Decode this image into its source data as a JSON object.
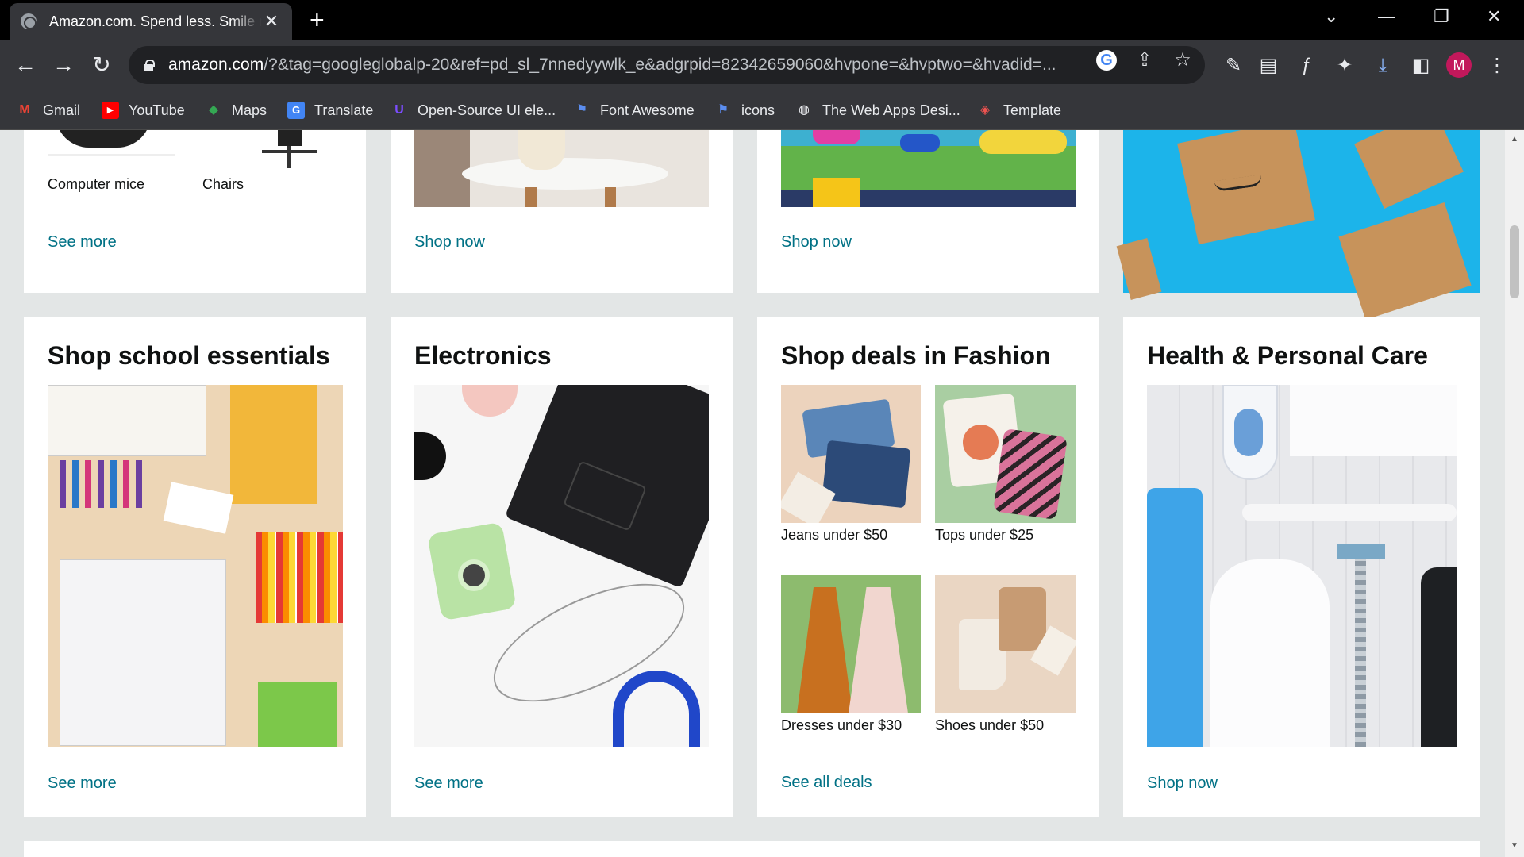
{
  "browser": {
    "tab_title": "Amazon.com. Spend less. Smile more.",
    "url_host": "amazon.com",
    "url_rest": "/?&tag=googleglobalp-20&ref=pd_sl_7nnedyywlk_e&adgrpid=82342659060&hvpone=&hvptwo=&hvadid=...",
    "profile_initial": "M",
    "bookmarks": [
      {
        "label": "Gmail",
        "icon": "gmail-icon"
      },
      {
        "label": "YouTube",
        "icon": "youtube-icon"
      },
      {
        "label": "Maps",
        "icon": "maps-icon"
      },
      {
        "label": "Translate",
        "icon": "translate-icon"
      },
      {
        "label": "Open-Source UI ele...",
        "icon": "ui-icon"
      },
      {
        "label": "Font Awesome",
        "icon": "flag-icon"
      },
      {
        "label": "icons",
        "icon": "flag-icon"
      },
      {
        "label": "The Web Apps Desi...",
        "icon": "globe-icon"
      },
      {
        "label": "Template",
        "icon": "template-icon"
      }
    ]
  },
  "top_row": {
    "card1": {
      "items": [
        "Computer mice",
        "Chairs"
      ],
      "link": "See more"
    },
    "card2": {
      "link": "Shop now"
    },
    "card3": {
      "link": "Shop now"
    }
  },
  "bottom_row": {
    "school": {
      "title": "Shop school essentials",
      "link": "See more"
    },
    "electronics": {
      "title": "Electronics",
      "link": "See more"
    },
    "fashion": {
      "title": "Shop deals in Fashion",
      "items": [
        "Jeans under $50",
        "Tops under $25",
        "Dresses under $30",
        "Shoes under $50"
      ],
      "link": "See all deals"
    },
    "health": {
      "title": "Health & Personal Care",
      "link": "Shop now"
    }
  },
  "colors": {
    "link": "#007185",
    "page_bg": "#e3e6e6",
    "chrome_bg": "#35363a"
  }
}
